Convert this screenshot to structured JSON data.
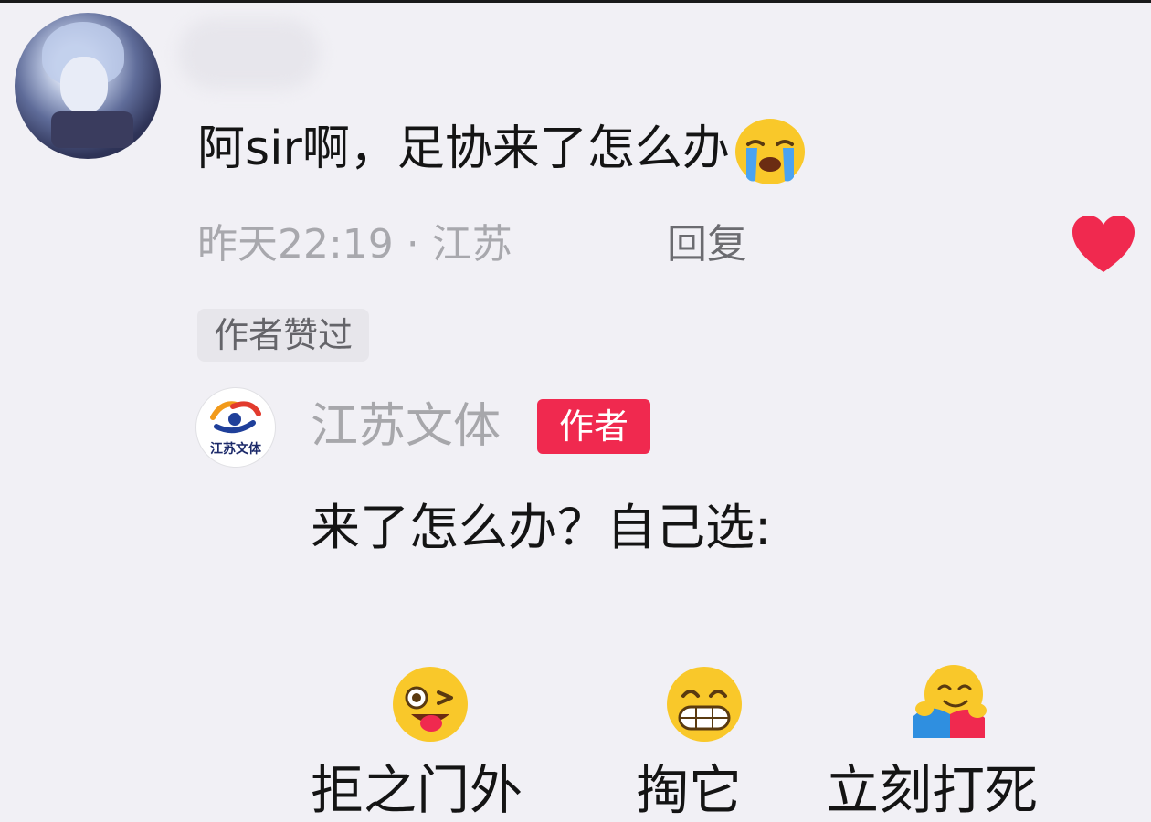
{
  "comment": {
    "text": "阿sir啊，足协来了怎么办",
    "emoji_icon": "loudly-crying-face-icon",
    "meta": "昨天22:19 · 江苏",
    "reply_label": "回复",
    "liked_icon": "heart-icon",
    "liked_by_author": "作者赞过"
  },
  "author_reply": {
    "name": "江苏文体",
    "badge": "作者",
    "avatar_text": "江苏文体",
    "text": "来了怎么办？自己选:",
    "options": [
      {
        "icon": "winking-tongue-face-icon",
        "label": "拒之门外"
      },
      {
        "icon": "grinning-face-icon",
        "label": "掏它"
      },
      {
        "icon": "hugging-face-icon",
        "label": "立刻打死"
      }
    ]
  },
  "colors": {
    "background": "#f1f0f5",
    "heart": "#f0294f",
    "author_badge": "#f0294f",
    "secondary_text": "#a8a8ad"
  }
}
